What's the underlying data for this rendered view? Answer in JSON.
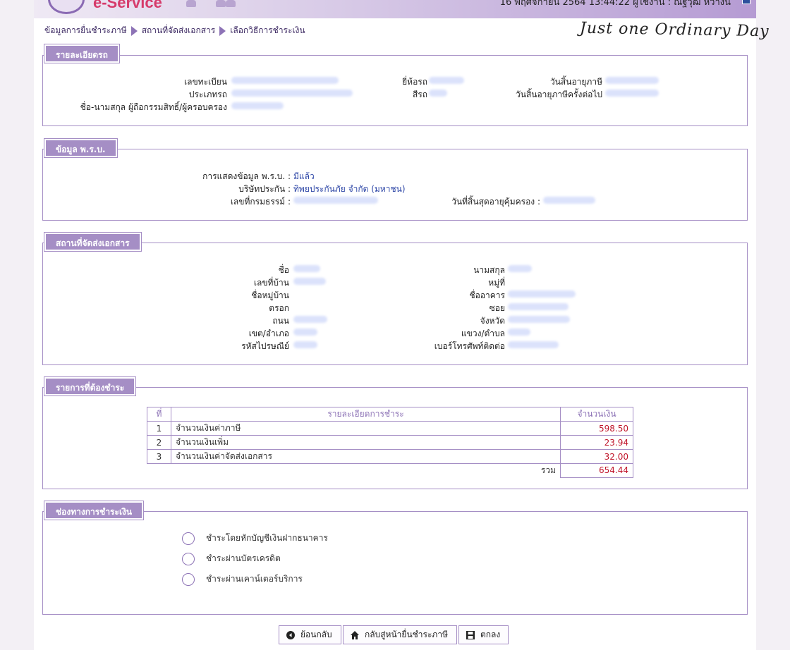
{
  "header": {
    "logo_text": "e-Service",
    "date_user_text": "16 พฤศจิกายน 2564 13:44:22 ผู้ใช้งาน : ณัฐวุฒิ หว่างนิ"
  },
  "breadcrumb": [
    "ข้อมูลการยื่นชำระภาษี",
    "สถานที่จัดส่งเอกสาร",
    "เลือกวิธีการชำระเงิน"
  ],
  "signature": "Just one Ordinary Day",
  "vehicle": {
    "title": "รายละเอียดรถ",
    "plate_label": "เลขทะเบียน",
    "type_label": "ประเภทรถ",
    "owner_label": "ชื่อ-นามสกุล ผู้ถือกรรมสิทธิ์/ผู้ครอบครอง",
    "brand_label": "ยี่ห้อรถ",
    "color_label": "สีรถ",
    "expiry_label": "วันสิ้นอายุภาษี",
    "next_expiry_label": "วันสิ้นอายุภาษีครั้งต่อไป"
  },
  "insurance": {
    "title": "ข้อมูล พ.ร.บ.",
    "display_label": "การแสดงข้อมูล พ.ร.บ. :",
    "display_value": "มีแล้ว",
    "company_label": "บริษัทประกัน :",
    "company_value": "ทิพยประกันภัย จำกัด (มหาชน)",
    "policy_label": "เลขที่กรมธรรม์ :",
    "coverage_end_label": "วันที่สิ้นสุดอายุคุ้มครอง :"
  },
  "delivery": {
    "title": "สถานที่จัดส่งเอกสาร",
    "name_label": "ชื่อ",
    "house_no_label": "เลขที่บ้าน",
    "village_label": "ชื่อหมู่บ้าน",
    "alley_label": "ตรอก",
    "road_label": "ถนน",
    "district_label": "เขต/อำเภอ",
    "postcode_label": "รหัสไปรษณีย์",
    "surname_label": "นามสกุล",
    "moo_label": "หมู่ที่",
    "building_label": "ชื่ออาคาร",
    "soi_label": "ซอย",
    "province_label": "จังหวัด",
    "subdistrict_label": "แขวง/ตำบล",
    "phone_label": "เบอร์โทรศัพท์ติดต่อ"
  },
  "payment_items": {
    "title": "รายการที่ต้องชำระ",
    "columns": [
      "ที่",
      "รายละเอียดการชำระ",
      "จำนวนเงิน"
    ],
    "rows": [
      {
        "no": "1",
        "desc": "จำนวนเงินค่าภาษี",
        "amount": "598.50"
      },
      {
        "no": "2",
        "desc": "จำนวนเงินเพิ่ม",
        "amount": "23.94"
      },
      {
        "no": "3",
        "desc": "จำนวนเงินค่าจัดส่งเอกสาร",
        "amount": "32.00"
      }
    ],
    "total_label": "รวม",
    "total_amount": "654.44"
  },
  "payment_channel": {
    "title": "ช่องทางการชำระเงิน",
    "options": [
      "ชำระโดยหักบัญชีเงินฝากธนาคาร",
      "ชำระผ่านบัตรเครดิต",
      "ชำระผ่านเคาน์เตอร์บริการ"
    ]
  },
  "buttons": {
    "back": "ย้อนกลับ",
    "home": "กลับสู่หน้ายื่นชำระภาษี",
    "ok": "ตกลง"
  },
  "colors": {
    "accent": "#a58ec5",
    "link_value": "#2c45a6",
    "amount_red": "#c0152a"
  }
}
